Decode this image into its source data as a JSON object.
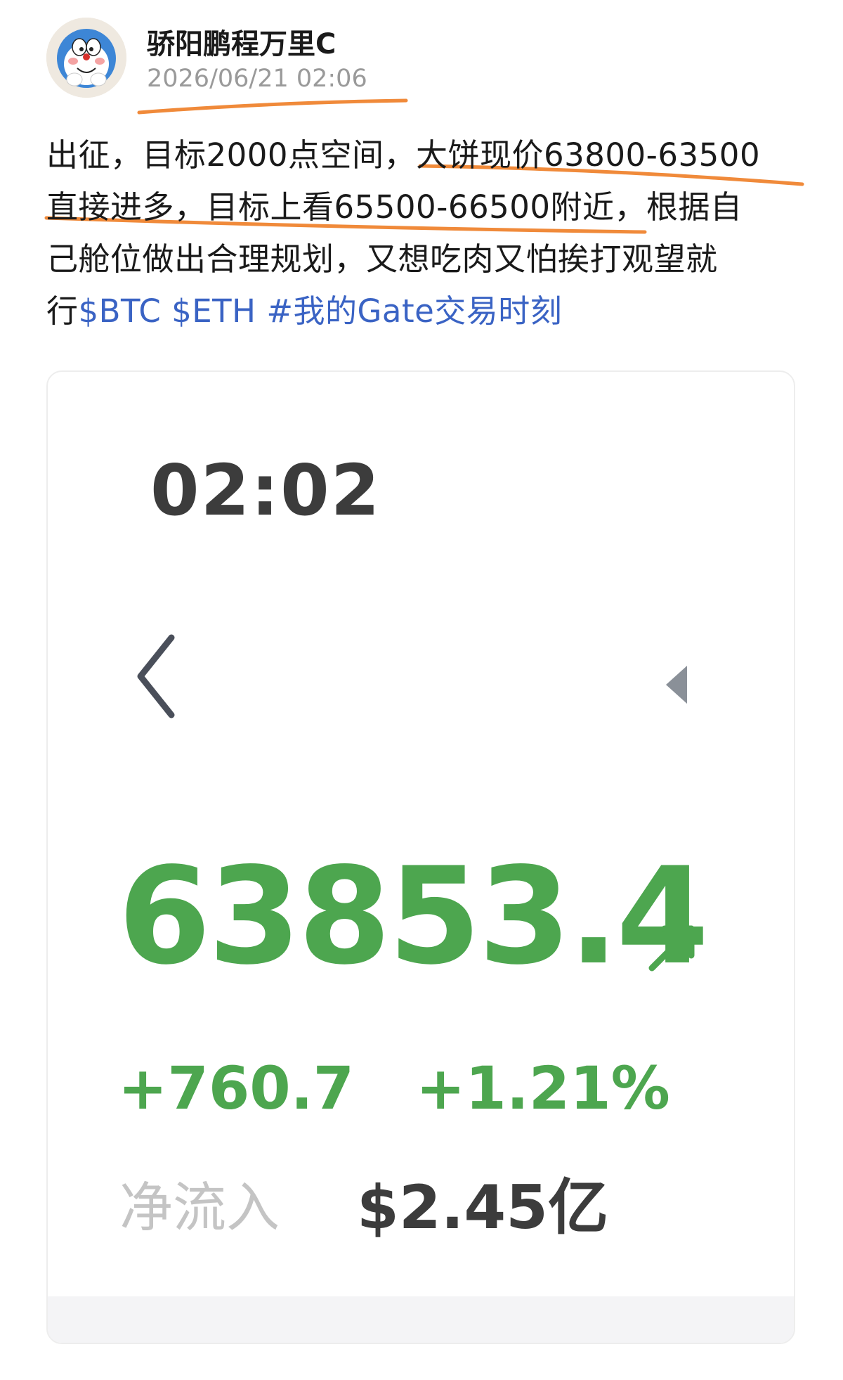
{
  "post": {
    "author": {
      "name": "骄阳鹏程万里C",
      "avatar_icon": "doraemon-avatar-icon"
    },
    "timestamp": "2026/06/21 02:06",
    "text": {
      "line1_a": "出征，目标2000点空间，",
      "line1_b": "大饼现价63800-63500",
      "line2_a": "直接进多，目标上看65500-66500附近",
      "line2_b": "，根据自",
      "line3": "己舱位做出合理规划，又想吃肉又怕挨打观望就",
      "line4_prefix": "行",
      "tags": [
        "$BTC",
        "$ETH",
        "#我的Gate交易时刻"
      ]
    },
    "annotation_color": "#f08a3a",
    "link_color": "#3a63c4"
  },
  "ticker_card": {
    "clock": "02:02",
    "price": "63853.4",
    "trend_icon": "arrow-up-right-icon",
    "change_abs": "+760.7",
    "change_pct": "+1.21%",
    "net_inflow_label": "净流入",
    "net_inflow_value": "$2.45亿",
    "positive_color": "#4da64f",
    "nav_back_icon": "chevron-left-icon",
    "nav_forward_icon": "caret-left-icon"
  }
}
